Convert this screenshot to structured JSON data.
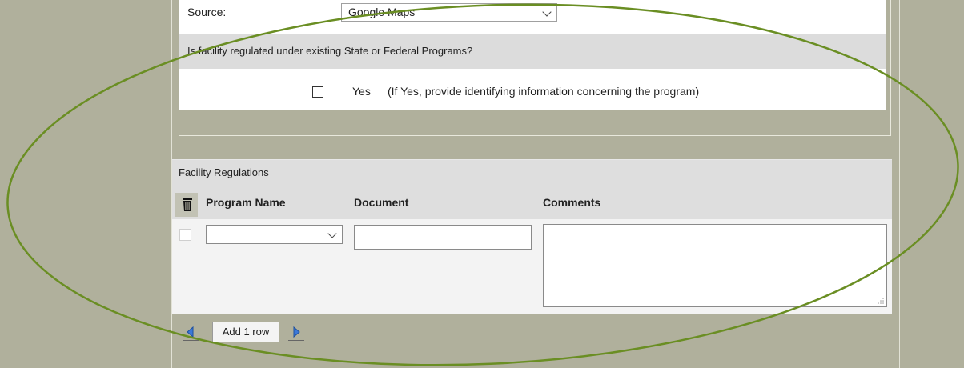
{
  "source": {
    "label": "Source:",
    "selected": "Google Maps"
  },
  "question": {
    "text": "Is facility regulated under existing State or Federal Programs?",
    "yes_label": "Yes",
    "yes_note": "(If Yes, provide identifying information concerning the program)"
  },
  "regulations": {
    "title": "Facility Regulations",
    "columns": {
      "program": "Program Name",
      "document": "Document",
      "comments": "Comments"
    },
    "row": {
      "program_value": "",
      "document_value": "",
      "comments_value": ""
    },
    "add_row_label": "Add 1 row"
  },
  "colors": {
    "background": "#b0b09c",
    "annotation_ellipse": "#6a8e23"
  },
  "icons": {
    "delete": "trash-icon",
    "prev": "arrow-left-icon",
    "next": "arrow-right-icon"
  }
}
